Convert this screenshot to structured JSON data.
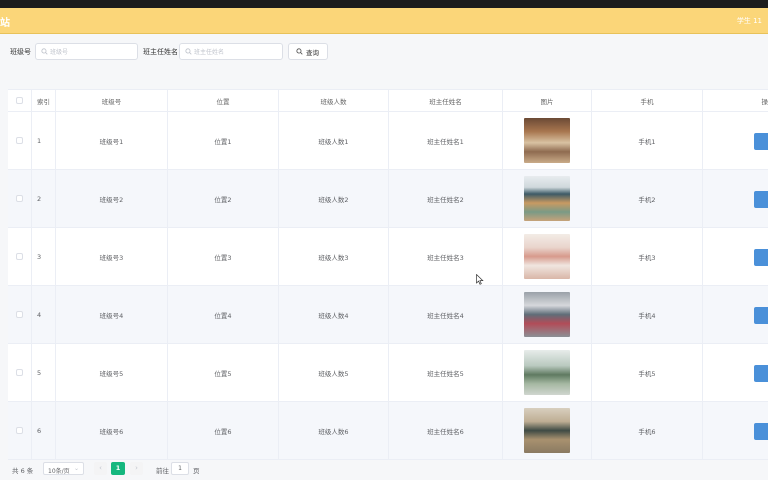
{
  "header": {
    "logo": "站",
    "user": "学生 11"
  },
  "search": {
    "field1": {
      "label": "班级号",
      "placeholder": "班级号"
    },
    "field2": {
      "label": "班主任姓名",
      "placeholder": "班主任姓名"
    },
    "button": "查询"
  },
  "table": {
    "columns": [
      "索引",
      "班级号",
      "位置",
      "班级人数",
      "班主任姓名",
      "图片",
      "手机",
      "操"
    ],
    "rows": [
      {
        "index": "1",
        "class_no": "班级号1",
        "location": "位置1",
        "count": "班级人数1",
        "teacher": "班主任姓名1",
        "phone": "手机1"
      },
      {
        "index": "2",
        "class_no": "班级号2",
        "location": "位置2",
        "count": "班级人数2",
        "teacher": "班主任姓名2",
        "phone": "手机2"
      },
      {
        "index": "3",
        "class_no": "班级号3",
        "location": "位置3",
        "count": "班级人数3",
        "teacher": "班主任姓名3",
        "phone": "手机3"
      },
      {
        "index": "4",
        "class_no": "班级号4",
        "location": "位置4",
        "count": "班级人数4",
        "teacher": "班主任姓名4",
        "phone": "手机4"
      },
      {
        "index": "5",
        "class_no": "班级号5",
        "location": "位置5",
        "count": "班级人数5",
        "teacher": "班主任姓名5",
        "phone": "手机5"
      },
      {
        "index": "6",
        "class_no": "班级号6",
        "location": "位置6",
        "count": "班级人数6",
        "teacher": "班主任姓名6",
        "phone": "手机6"
      }
    ]
  },
  "pager": {
    "total": "共 6 条",
    "page_size": "10条/页",
    "prev": "‹",
    "current": "1",
    "next": "›",
    "goto_label": "前往",
    "goto_value": "1",
    "page_label": "页"
  },
  "colors": {
    "header": "#fbd679",
    "accent": "#15b77e",
    "op_button": "#4a90d9"
  }
}
